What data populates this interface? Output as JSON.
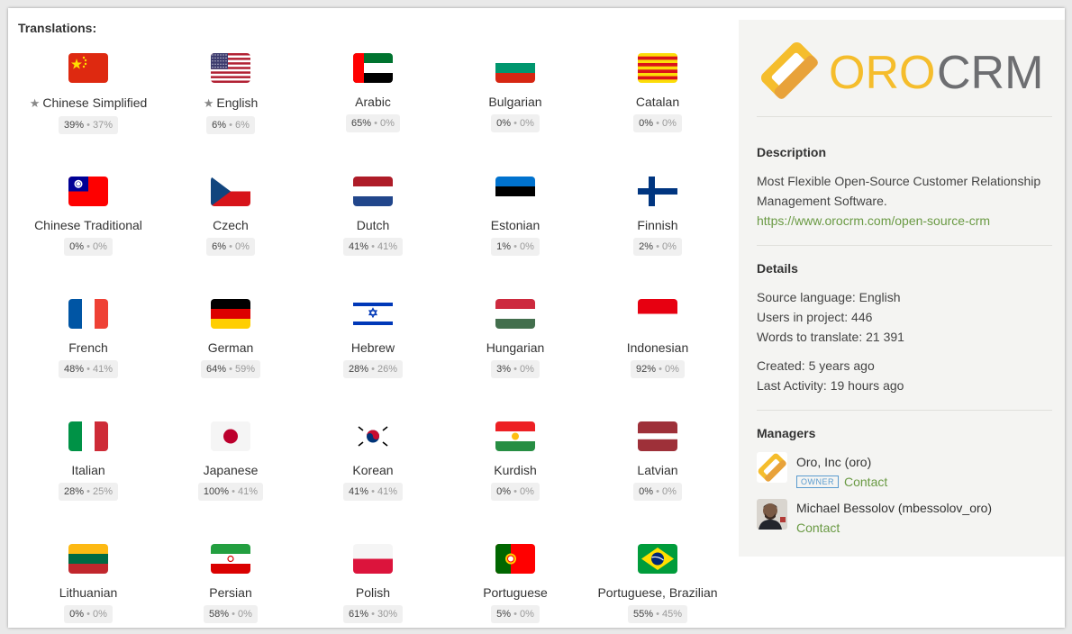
{
  "translations": {
    "heading": "Translations:",
    "languages": [
      {
        "name": "Chinese Simplified",
        "starred": true,
        "translated": "39%",
        "approved": "37%",
        "flag_icon": "china-flag-icon"
      },
      {
        "name": "English",
        "starred": true,
        "translated": "6%",
        "approved": "6%",
        "flag_icon": "usa-flag-icon"
      },
      {
        "name": "Arabic",
        "starred": false,
        "translated": "65%",
        "approved": "0%",
        "flag_icon": "uae-flag-icon"
      },
      {
        "name": "Bulgarian",
        "starred": false,
        "translated": "0%",
        "approved": "0%",
        "flag_icon": "bulgaria-flag-icon"
      },
      {
        "name": "Catalan",
        "starred": false,
        "translated": "0%",
        "approved": "0%",
        "flag_icon": "catalonia-flag-icon"
      },
      {
        "name": "Chinese Traditional",
        "starred": false,
        "translated": "0%",
        "approved": "0%",
        "flag_icon": "taiwan-flag-icon"
      },
      {
        "name": "Czech",
        "starred": false,
        "translated": "6%",
        "approved": "0%",
        "flag_icon": "czech-flag-icon"
      },
      {
        "name": "Dutch",
        "starred": false,
        "translated": "41%",
        "approved": "41%",
        "flag_icon": "netherlands-flag-icon"
      },
      {
        "name": "Estonian",
        "starred": false,
        "translated": "1%",
        "approved": "0%",
        "flag_icon": "estonia-flag-icon"
      },
      {
        "name": "Finnish",
        "starred": false,
        "translated": "2%",
        "approved": "0%",
        "flag_icon": "finland-flag-icon"
      },
      {
        "name": "French",
        "starred": false,
        "translated": "48%",
        "approved": "41%",
        "flag_icon": "france-flag-icon"
      },
      {
        "name": "German",
        "starred": false,
        "translated": "64%",
        "approved": "59%",
        "flag_icon": "germany-flag-icon"
      },
      {
        "name": "Hebrew",
        "starred": false,
        "translated": "28%",
        "approved": "26%",
        "flag_icon": "israel-flag-icon"
      },
      {
        "name": "Hungarian",
        "starred": false,
        "translated": "3%",
        "approved": "0%",
        "flag_icon": "hungary-flag-icon"
      },
      {
        "name": "Indonesian",
        "starred": false,
        "translated": "92%",
        "approved": "0%",
        "flag_icon": "indonesia-flag-icon"
      },
      {
        "name": "Italian",
        "starred": false,
        "translated": "28%",
        "approved": "25%",
        "flag_icon": "italy-flag-icon"
      },
      {
        "name": "Japanese",
        "starred": false,
        "translated": "100%",
        "approved": "41%",
        "flag_icon": "japan-flag-icon"
      },
      {
        "name": "Korean",
        "starred": false,
        "translated": "41%",
        "approved": "41%",
        "flag_icon": "korea-flag-icon"
      },
      {
        "name": "Kurdish",
        "starred": false,
        "translated": "0%",
        "approved": "0%",
        "flag_icon": "kurdistan-flag-icon"
      },
      {
        "name": "Latvian",
        "starred": false,
        "translated": "0%",
        "approved": "0%",
        "flag_icon": "latvia-flag-icon"
      },
      {
        "name": "Lithuanian",
        "starred": false,
        "translated": "0%",
        "approved": "0%",
        "flag_icon": "lithuania-flag-icon"
      },
      {
        "name": "Persian",
        "starred": false,
        "translated": "58%",
        "approved": "0%",
        "flag_icon": "iran-flag-icon"
      },
      {
        "name": "Polish",
        "starred": false,
        "translated": "61%",
        "approved": "30%",
        "flag_icon": "poland-flag-icon"
      },
      {
        "name": "Portuguese",
        "starred": false,
        "translated": "5%",
        "approved": "0%",
        "flag_icon": "portugal-flag-icon"
      },
      {
        "name": "Portuguese, Brazilian",
        "starred": false,
        "translated": "55%",
        "approved": "45%",
        "flag_icon": "brazil-flag-icon"
      }
    ],
    "separator": "•"
  },
  "sidebar": {
    "logo": {
      "text_oro": "ORO",
      "text_crm": "CRM",
      "icon": "orocrm-logo-icon",
      "color_oro": "#f5bd2c",
      "color_crm": "#6d6e71"
    },
    "description": {
      "title": "Description",
      "line1": "Most Flexible Open-Source Customer Relationship",
      "line2": "Management Software.",
      "url": "https://www.orocrm.com/open-source-crm"
    },
    "details": {
      "title": "Details",
      "source_language": "Source language: English",
      "users": "Users in project: 446",
      "words": "Words to translate: 21 391",
      "created": "Created: 5 years ago",
      "last_activity": "Last Activity: 19 hours ago"
    },
    "managers": {
      "title": "Managers",
      "list": [
        {
          "name": "Oro, Inc (oro)",
          "badge": "OWNER",
          "contact": "Contact",
          "avatar": "oro-avatar-icon"
        },
        {
          "name": "Michael Bessolov (mbessolov_oro)",
          "badge": "",
          "contact": "Contact",
          "avatar": "user-photo-avatar"
        }
      ]
    }
  },
  "colors": {
    "link": "#6a9a44",
    "owner_badge": "#5a9bcf"
  }
}
